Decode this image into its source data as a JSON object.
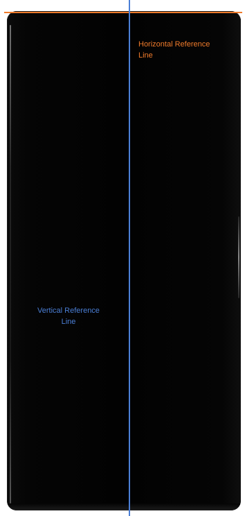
{
  "figure": {
    "horizontal_reference": {
      "label_line1": "Horizontal Reference",
      "label_line2": "Line",
      "color": "#f07b2b"
    },
    "vertical_reference": {
      "label_line1": "Vertical Reference",
      "label_line2": "Line",
      "color": "#4b7fd6"
    },
    "device_color": "#020202"
  }
}
